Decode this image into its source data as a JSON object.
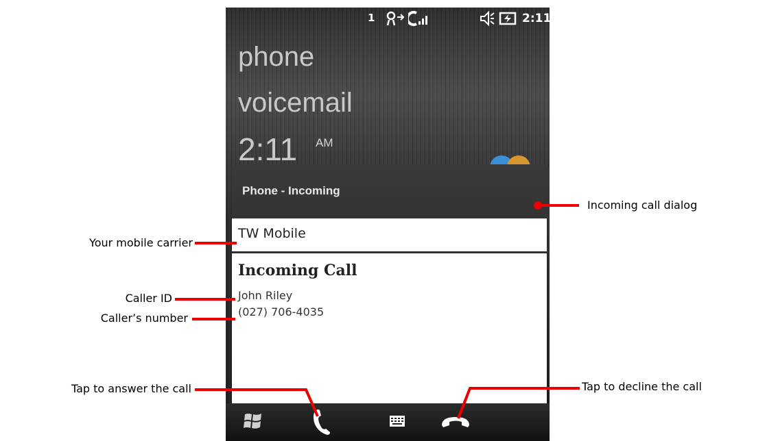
{
  "status_bar": {
    "sim_number": "1",
    "time": "2:11",
    "icons": [
      "data-sync-icon",
      "signal-strength-icon",
      "speaker-muted-icon",
      "battery-charging-icon"
    ]
  },
  "home": {
    "phone_label": "phone",
    "voicemail_label": "voicemail",
    "time": "2:11",
    "ampm": "AM"
  },
  "dialog": {
    "title": "Phone - Incoming",
    "carrier": "TW Mobile",
    "heading": "Incoming Call",
    "caller_name": "John Riley",
    "caller_number": "(027) 706-4035"
  },
  "softkeys": [
    "start-icon",
    "answer-call-icon",
    "keyboard-icon",
    "decline-call-icon"
  ],
  "annotations": {
    "incoming_dialog": "Incoming call dialog",
    "carrier": "Your mobile carrier",
    "caller_id": "Caller ID",
    "caller_number": "Caller’s number",
    "answer": "Tap to answer the call",
    "decline": "Tap to decline the call"
  },
  "colors": {
    "annotation_line": "#ee0000",
    "dialog_background": "#1b1b1b",
    "answer_icon": "#ffffff"
  }
}
